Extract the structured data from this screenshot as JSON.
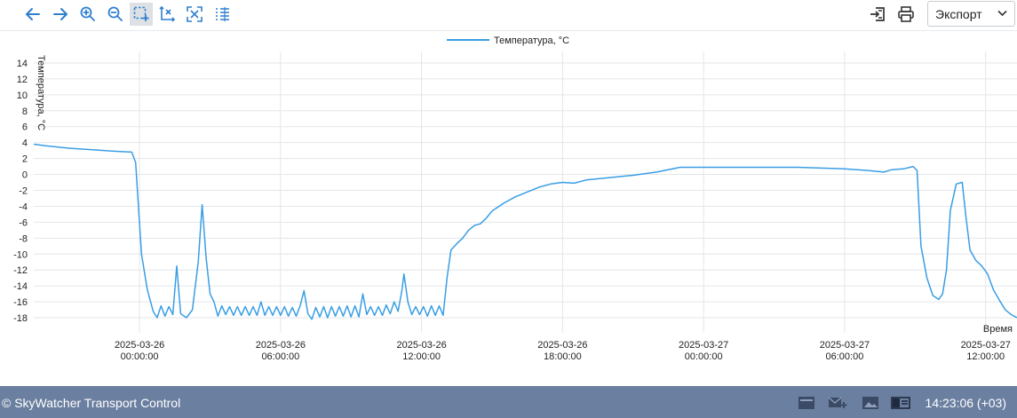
{
  "toolbar": {
    "tools": [
      {
        "name": "back-arrow-icon"
      },
      {
        "name": "forward-arrow-icon"
      },
      {
        "name": "zoom-in-icon"
      },
      {
        "name": "zoom-out-icon"
      },
      {
        "name": "box-select-icon",
        "active": true
      },
      {
        "name": "axis-select-icon"
      },
      {
        "name": "reset-zoom-icon"
      },
      {
        "name": "list-icon"
      }
    ],
    "export_label": "Экспорт"
  },
  "chart_data": {
    "type": "line",
    "legend_position": "top-center",
    "xlabel": "Время",
    "ylabel": "Температура, °C",
    "ylim": [
      -19,
      15
    ],
    "yticks": [
      14,
      12,
      10,
      8,
      6,
      4,
      2,
      0,
      -2,
      -4,
      -6,
      -8,
      -10,
      -12,
      -14,
      -16,
      -18
    ],
    "xlim": [
      "2025-03-25 19:30",
      "2025-03-27 13:20"
    ],
    "xticks": [
      {
        "date": "2025-03-26",
        "time": "00:00:00",
        "t": "2025-03-26 00:00"
      },
      {
        "date": "2025-03-26",
        "time": "06:00:00",
        "t": "2025-03-26 06:00"
      },
      {
        "date": "2025-03-26",
        "time": "12:00:00",
        "t": "2025-03-26 12:00"
      },
      {
        "date": "2025-03-26",
        "time": "18:00:00",
        "t": "2025-03-26 18:00"
      },
      {
        "date": "2025-03-27",
        "time": "00:00:00",
        "t": "2025-03-27 00:00"
      },
      {
        "date": "2025-03-27",
        "time": "06:00:00",
        "t": "2025-03-27 06:00"
      },
      {
        "date": "2025-03-27",
        "time": "12:00:00",
        "t": "2025-03-27 12:00"
      }
    ],
    "grid": true,
    "colors": {
      "line": "#3a9ee4",
      "grid": "#e3e6ea"
    },
    "series": [
      {
        "name": "Температура, °C",
        "points": [
          [
            "2025-03-25 19:30",
            3.8
          ],
          [
            "2025-03-25 20:00",
            3.6
          ],
          [
            "2025-03-25 21:00",
            3.3
          ],
          [
            "2025-03-25 22:00",
            3.1
          ],
          [
            "2025-03-25 23:00",
            2.9
          ],
          [
            "2025-03-25 23:40",
            2.8
          ],
          [
            "2025-03-25 23:50",
            1.5
          ],
          [
            "2025-03-26 00:05",
            -10.0
          ],
          [
            "2025-03-26 00:20",
            -14.5
          ],
          [
            "2025-03-26 00:35",
            -17.2
          ],
          [
            "2025-03-26 00:45",
            -18.0
          ],
          [
            "2025-03-26 00:55",
            -16.5
          ],
          [
            "2025-03-26 01:05",
            -17.8
          ],
          [
            "2025-03-26 01:15",
            -16.6
          ],
          [
            "2025-03-26 01:25",
            -17.6
          ],
          [
            "2025-03-26 01:35",
            -11.5
          ],
          [
            "2025-03-26 01:45",
            -17.5
          ],
          [
            "2025-03-26 02:00",
            -18.0
          ],
          [
            "2025-03-26 02:15",
            -17.0
          ],
          [
            "2025-03-26 02:30",
            -11.0
          ],
          [
            "2025-03-26 02:40",
            -3.8
          ],
          [
            "2025-03-26 02:50",
            -10.5
          ],
          [
            "2025-03-26 03:00",
            -15.0
          ],
          [
            "2025-03-26 03:10",
            -16.0
          ],
          [
            "2025-03-26 03:20",
            -17.8
          ],
          [
            "2025-03-26 03:30",
            -16.5
          ],
          [
            "2025-03-26 03:40",
            -17.6
          ],
          [
            "2025-03-26 03:50",
            -16.6
          ],
          [
            "2025-03-26 04:00",
            -17.7
          ],
          [
            "2025-03-26 04:10",
            -16.6
          ],
          [
            "2025-03-26 04:20",
            -17.7
          ],
          [
            "2025-03-26 04:30",
            -16.6
          ],
          [
            "2025-03-26 04:40",
            -17.7
          ],
          [
            "2025-03-26 04:50",
            -16.6
          ],
          [
            "2025-03-26 05:00",
            -17.7
          ],
          [
            "2025-03-26 05:10",
            -16.0
          ],
          [
            "2025-03-26 05:20",
            -17.7
          ],
          [
            "2025-03-26 05:30",
            -16.6
          ],
          [
            "2025-03-26 05:40",
            -17.7
          ],
          [
            "2025-03-26 05:50",
            -16.6
          ],
          [
            "2025-03-26 06:00",
            -17.7
          ],
          [
            "2025-03-26 06:10",
            -16.6
          ],
          [
            "2025-03-26 06:20",
            -17.8
          ],
          [
            "2025-03-26 06:30",
            -16.7
          ],
          [
            "2025-03-26 06:40",
            -17.8
          ],
          [
            "2025-03-26 06:50",
            -16.5
          ],
          [
            "2025-03-26 07:00",
            -14.6
          ],
          [
            "2025-03-26 07:10",
            -17.5
          ],
          [
            "2025-03-26 07:20",
            -18.2
          ],
          [
            "2025-03-26 07:30",
            -16.7
          ],
          [
            "2025-03-26 07:40",
            -17.9
          ],
          [
            "2025-03-26 07:50",
            -16.6
          ],
          [
            "2025-03-26 08:00",
            -18.0
          ],
          [
            "2025-03-26 08:10",
            -16.6
          ],
          [
            "2025-03-26 08:20",
            -17.8
          ],
          [
            "2025-03-26 08:30",
            -16.6
          ],
          [
            "2025-03-26 08:40",
            -17.8
          ],
          [
            "2025-03-26 08:50",
            -16.5
          ],
          [
            "2025-03-26 09:00",
            -17.9
          ],
          [
            "2025-03-26 09:10",
            -16.5
          ],
          [
            "2025-03-26 09:20",
            -17.9
          ],
          [
            "2025-03-26 09:30",
            -15.0
          ],
          [
            "2025-03-26 09:40",
            -17.6
          ],
          [
            "2025-03-26 09:50",
            -16.6
          ],
          [
            "2025-03-26 10:00",
            -17.7
          ],
          [
            "2025-03-26 10:10",
            -16.6
          ],
          [
            "2025-03-26 10:20",
            -17.7
          ],
          [
            "2025-03-26 10:30",
            -16.4
          ],
          [
            "2025-03-26 10:40",
            -17.5
          ],
          [
            "2025-03-26 10:50",
            -16.0
          ],
          [
            "2025-03-26 11:00",
            -17.2
          ],
          [
            "2025-03-26 11:10",
            -14.5
          ],
          [
            "2025-03-26 11:15",
            -12.5
          ],
          [
            "2025-03-26 11:25",
            -16.0
          ],
          [
            "2025-03-26 11:35",
            -17.6
          ],
          [
            "2025-03-26 11:45",
            -16.6
          ],
          [
            "2025-03-26 11:55",
            -17.6
          ],
          [
            "2025-03-26 12:05",
            -16.6
          ],
          [
            "2025-03-26 12:15",
            -17.8
          ],
          [
            "2025-03-26 12:25",
            -16.5
          ],
          [
            "2025-03-26 12:35",
            -17.7
          ],
          [
            "2025-03-26 12:45",
            -16.5
          ],
          [
            "2025-03-26 12:55",
            -17.7
          ],
          [
            "2025-03-26 13:05",
            -13.0
          ],
          [
            "2025-03-26 13:15",
            -9.5
          ],
          [
            "2025-03-26 13:30",
            -8.7
          ],
          [
            "2025-03-26 13:45",
            -8.0
          ],
          [
            "2025-03-26 14:00",
            -7.0
          ],
          [
            "2025-03-26 14:15",
            -6.4
          ],
          [
            "2025-03-26 14:30",
            -6.2
          ],
          [
            "2025-03-26 14:45",
            -5.5
          ],
          [
            "2025-03-26 15:00",
            -4.6
          ],
          [
            "2025-03-26 15:30",
            -3.6
          ],
          [
            "2025-03-26 16:00",
            -2.8
          ],
          [
            "2025-03-26 16:30",
            -2.2
          ],
          [
            "2025-03-26 17:00",
            -1.6
          ],
          [
            "2025-03-26 17:30",
            -1.2
          ],
          [
            "2025-03-26 18:00",
            -1.0
          ],
          [
            "2025-03-26 18:30",
            -1.1
          ],
          [
            "2025-03-26 19:00",
            -0.7
          ],
          [
            "2025-03-26 20:00",
            -0.4
          ],
          [
            "2025-03-26 21:00",
            -0.1
          ],
          [
            "2025-03-26 22:00",
            0.3
          ],
          [
            "2025-03-26 23:00",
            0.9
          ],
          [
            "2025-03-27 00:00",
            0.9
          ],
          [
            "2025-03-27 01:00",
            0.9
          ],
          [
            "2025-03-27 02:00",
            0.9
          ],
          [
            "2025-03-27 03:00",
            0.9
          ],
          [
            "2025-03-27 04:00",
            0.9
          ],
          [
            "2025-03-27 05:00",
            0.8
          ],
          [
            "2025-03-27 06:00",
            0.7
          ],
          [
            "2025-03-27 07:00",
            0.5
          ],
          [
            "2025-03-27 07:40",
            0.3
          ],
          [
            "2025-03-27 08:00",
            0.6
          ],
          [
            "2025-03-27 08:30",
            0.7
          ],
          [
            "2025-03-27 08:55",
            1.0
          ],
          [
            "2025-03-27 09:05",
            0.5
          ],
          [
            "2025-03-27 09:15",
            -9.0
          ],
          [
            "2025-03-27 09:30",
            -13.0
          ],
          [
            "2025-03-27 09:45",
            -15.2
          ],
          [
            "2025-03-27 10:00",
            -15.7
          ],
          [
            "2025-03-27 10:10",
            -15.0
          ],
          [
            "2025-03-27 10:20",
            -12.0
          ],
          [
            "2025-03-27 10:30",
            -4.5
          ],
          [
            "2025-03-27 10:45",
            -1.2
          ],
          [
            "2025-03-27 11:00",
            -1.0
          ],
          [
            "2025-03-27 11:10",
            -5.5
          ],
          [
            "2025-03-27 11:20",
            -9.5
          ],
          [
            "2025-03-27 11:35",
            -10.8
          ],
          [
            "2025-03-27 11:50",
            -11.5
          ],
          [
            "2025-03-27 12:05",
            -12.5
          ],
          [
            "2025-03-27 12:20",
            -14.5
          ],
          [
            "2025-03-27 12:35",
            -15.8
          ],
          [
            "2025-03-27 12:50",
            -17.0
          ],
          [
            "2025-03-27 13:05",
            -17.6
          ],
          [
            "2025-03-27 13:20",
            -18.0
          ]
        ]
      }
    ]
  },
  "status": {
    "copyright": "© SkyWatcher Transport Control",
    "time": "14:23:06 (+03)",
    "icons": [
      "inbox-icon",
      "mail-add-icon",
      "image-icon",
      "panel-icon"
    ]
  }
}
